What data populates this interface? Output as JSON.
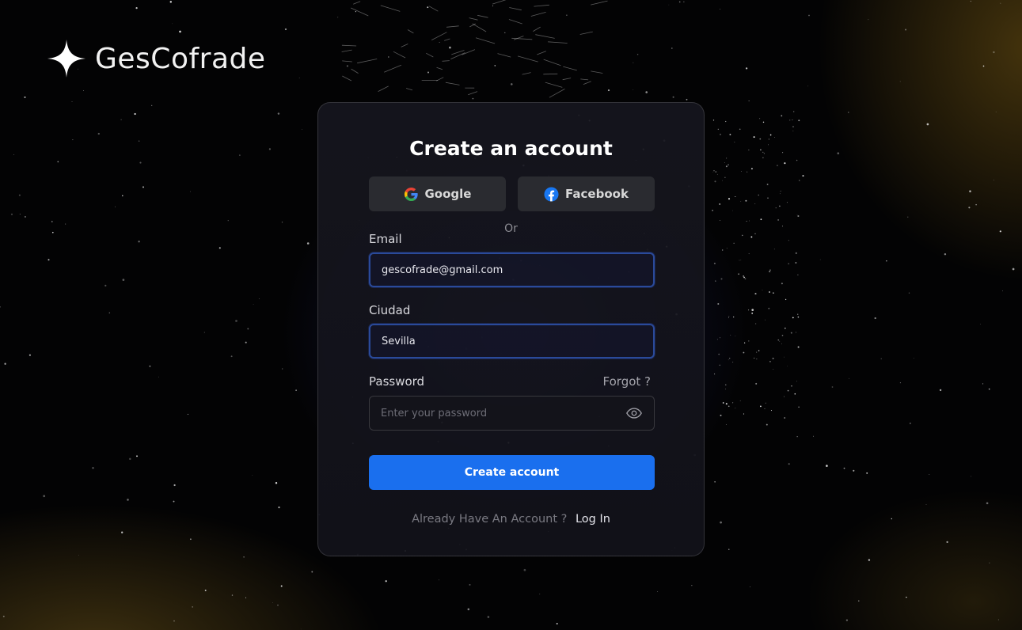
{
  "brand": {
    "name": "GesCofrade",
    "icon": "sparkle-star-icon"
  },
  "card": {
    "title": "Create an account",
    "social": {
      "google_label": "Google",
      "google_icon": "google-icon",
      "facebook_label": "Facebook",
      "facebook_icon": "facebook-icon"
    },
    "divider_text": "Or",
    "email": {
      "label": "Email",
      "value": "gescofrade@gmail.com"
    },
    "city": {
      "label": "Ciudad",
      "value": "Sevilla"
    },
    "password": {
      "label": "Password",
      "placeholder": "Enter your password",
      "forgot_label": "Forgot ?",
      "visibility_icon": "eye-icon"
    },
    "submit_label": "Create account",
    "footer": {
      "prompt": "Already Have An Account ?",
      "link_label": "Log In"
    }
  },
  "colors": {
    "accent": "#1a6fee",
    "focus_border": "#2a4a9a",
    "card_bg": "#16161e",
    "page_bg": "#030304"
  }
}
